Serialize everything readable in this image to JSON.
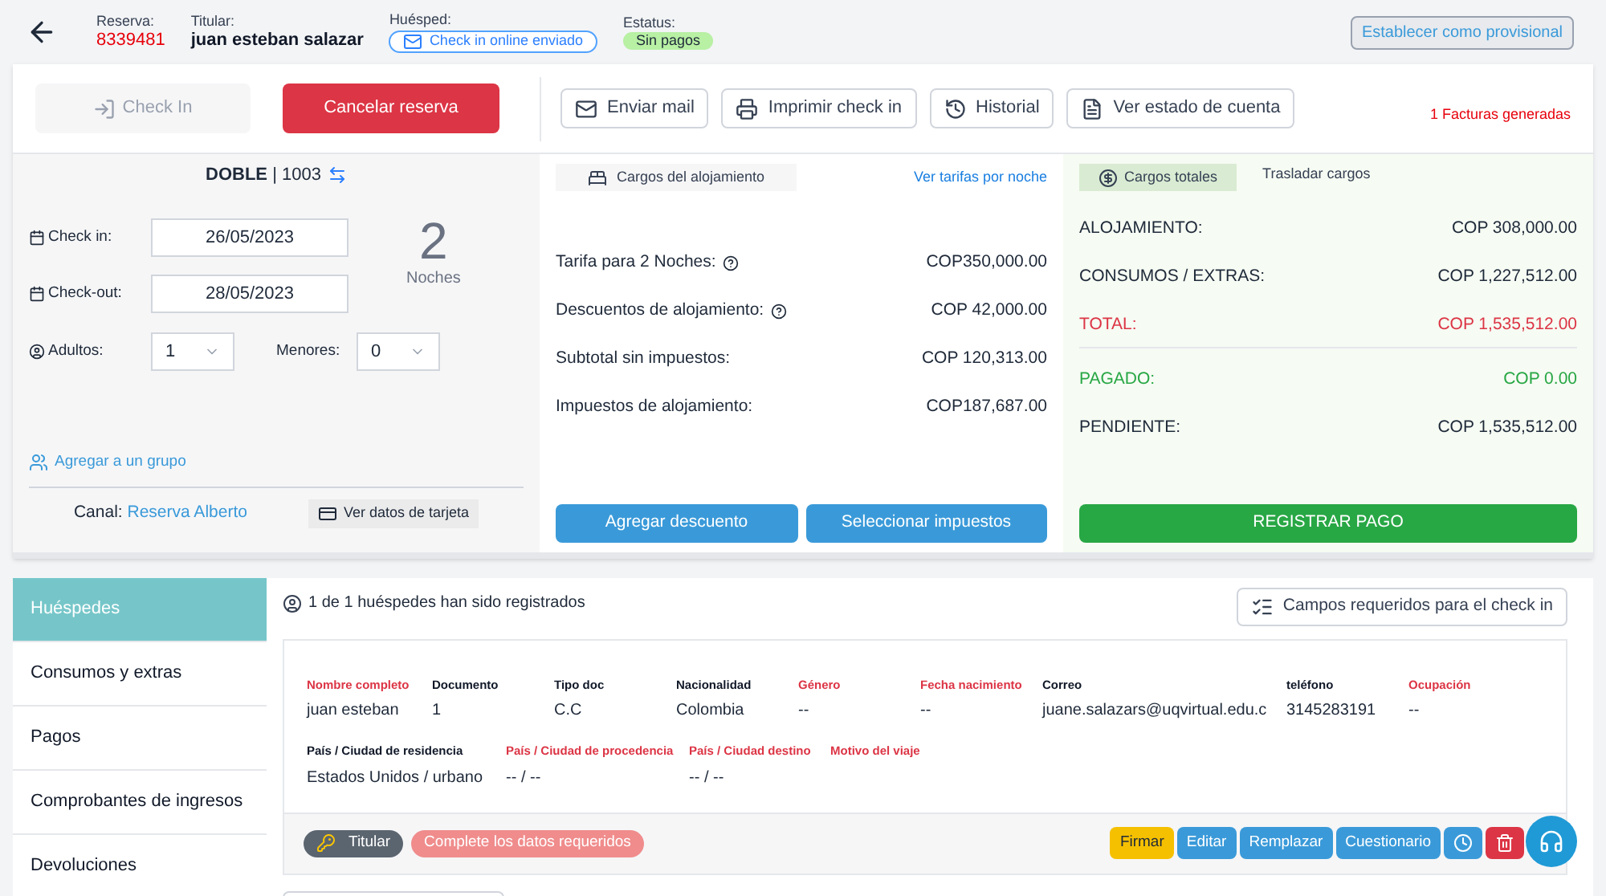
{
  "header": {
    "reserva_label": "Reserva:",
    "reserva_number": "8339481",
    "titular_label": "Titular:",
    "titular_name": "juan esteban salazar",
    "huesped_label": "Huésped:",
    "huesped_badge": "Check in online enviado",
    "estatus_label": "Estatus:",
    "estatus_badge": "Sin pagos",
    "provisional_button": "Establecer como provisional"
  },
  "toolbar": {
    "checkin_button": {
      "label": "Check In",
      "disabled": true
    },
    "cancel_button": "Cancelar reserva",
    "buttons": [
      {
        "label": "Enviar mail",
        "kind": "mail"
      },
      {
        "label": "Imprimir check in",
        "kind": "print"
      },
      {
        "label": "Historial",
        "kind": "history"
      },
      {
        "label": "Ver estado de cuenta",
        "kind": "account"
      }
    ],
    "invoices_note": "1 Facturas generadas"
  },
  "stay": {
    "room": "**DOBLE** | 1003",
    "checkin_label": "Check in:",
    "checkin_value": "26/05/2023",
    "checkout_label": "Check-out:",
    "checkout_value": "28/05/2023",
    "nights_count": "2",
    "nights_label": "Noches",
    "adults_label": "Adultos:",
    "adults_value": "1",
    "minors_label": "Menores:",
    "minors_value": "0",
    "group_link": "Agregar a un grupo",
    "channel_label": "Canal:",
    "channel_value": "Reserva Alberto",
    "card_button": "Ver datos de tarjeta"
  },
  "charges": {
    "tab": "Cargos del alojamiento",
    "rates_link": "Ver tarifas por noche",
    "rows": [
      {
        "label": "Tarifa para 2 Noches:",
        "value": "COP350,000.00",
        "help": true
      },
      {
        "label": "Descuentos de alojamiento:",
        "value": "COP 42,000.00",
        "help": true
      },
      {
        "label": "Subtotal sin impuestos:",
        "value": "COP 120,313.00",
        "help": false
      },
      {
        "label": "Impuestos de alojamiento:",
        "value": "COP187,687.00",
        "help": false
      }
    ],
    "buttons": [
      "Agregar descuento",
      "Seleccionar impuestos"
    ]
  },
  "totals": {
    "tabs": [
      {
        "label": "Cargos totales",
        "selected": true
      },
      {
        "label": "Trasladar cargos",
        "selected": false
      }
    ],
    "rows": [
      {
        "label": "ALOJAMIENTO:",
        "value": "COP 308,000.00",
        "kind": "normal"
      },
      {
        "label": "CONSUMOS / EXTRAS:",
        "value": "COP 1,227,512.00",
        "kind": "normal"
      },
      {
        "label": "TOTAL:",
        "value": "COP 1,535,512.00",
        "kind": "total"
      },
      {
        "label": "PAGADO:",
        "value": "COP 0.00",
        "kind": "paid"
      },
      {
        "label": "PENDIENTE:",
        "value": "COP 1,535,512.00",
        "kind": "normal"
      }
    ],
    "pay_button": "REGISTRAR PAGO"
  },
  "sidebar": {
    "items": [
      {
        "label": "Huéspedes",
        "selected": true
      },
      {
        "label": "Consumos y extras",
        "selected": false
      },
      {
        "label": "Pagos",
        "selected": false
      },
      {
        "label": "Comprobantes de ingresos",
        "selected": false
      },
      {
        "label": "Devoluciones",
        "selected": false
      }
    ]
  },
  "guests": {
    "summary": "1 de 1 huéspedes han sido registrados",
    "required_fields_button": "Campos requeridos para el check in",
    "row_1": [
      {
        "label": "Nombre completo",
        "value": "juan esteban",
        "required": true
      },
      {
        "label": "Documento",
        "value": "1",
        "required": false
      },
      {
        "label": "Tipo doc",
        "value": "C.C",
        "required": false
      },
      {
        "label": "Nacionalidad",
        "value": "Colombia",
        "required": false
      },
      {
        "label": "Género",
        "value": "--",
        "required": true
      },
      {
        "label": "Fecha nacimiento",
        "value": "--",
        "required": true
      },
      {
        "label": "Correo",
        "value": "juane.salazars@uqvirtual.edu.c",
        "required": false
      },
      {
        "label": "teléfono",
        "value": "3145283191",
        "required": false
      },
      {
        "label": "Ocupación",
        "value": "--",
        "required": true
      }
    ],
    "row_2": [
      {
        "label": "País / Ciudad de residencia",
        "value": "Estados Unidos / urbano",
        "required": false
      },
      {
        "label": "País / Ciudad de procedencia",
        "value": "-- / --",
        "required": true
      },
      {
        "label": "País / Ciudad destino",
        "value": "-- / --",
        "required": true
      },
      {
        "label": "Motivo del viaje",
        "required": true
      }
    ],
    "holder_badge": "Titular",
    "incomplete_badge": "Complete los datos requeridos",
    "actions": [
      {
        "label": "Firmar",
        "kind": "warning"
      },
      {
        "label": "Editar",
        "kind": "primary"
      },
      {
        "label": "Remplazar",
        "kind": "primary"
      },
      {
        "label": "Cuestionario",
        "kind": "primary"
      },
      {
        "kind": "history"
      },
      {
        "kind": "delete"
      }
    ]
  }
}
